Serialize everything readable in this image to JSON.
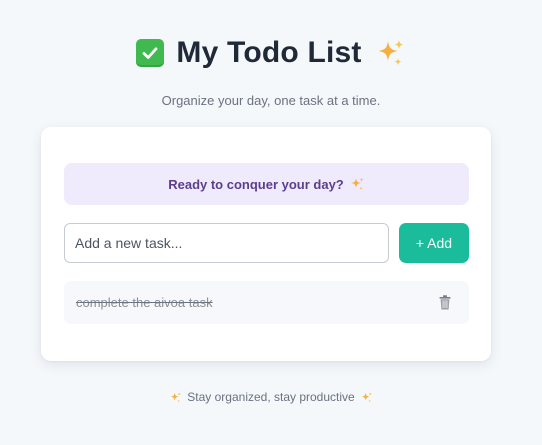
{
  "header": {
    "title": "My Todo List",
    "title_icon_left": "check-box-icon",
    "title_icon_right": "sparkles-icon",
    "subtitle": "Organize your day, one task at a time."
  },
  "banner": {
    "text": "Ready to conquer your day?",
    "icon": "sparkles-icon"
  },
  "form": {
    "input_value": "",
    "input_placeholder": "Add a new task...",
    "add_button_label": "+ Add"
  },
  "tasks": [
    {
      "text": "complete the aivoa task",
      "completed": true,
      "delete_icon": "trash-icon"
    }
  ],
  "footer": {
    "text": "Stay organized, stay productive",
    "icon": "sparkles-icon"
  },
  "colors": {
    "page_background": "#f4f8fb",
    "card_background": "#ffffff",
    "banner_background": "#f0eafd",
    "banner_text": "#5b3e8c",
    "accent": "#1abc9c",
    "check_green": "#3fb950",
    "sparkle": "#f5b041"
  }
}
